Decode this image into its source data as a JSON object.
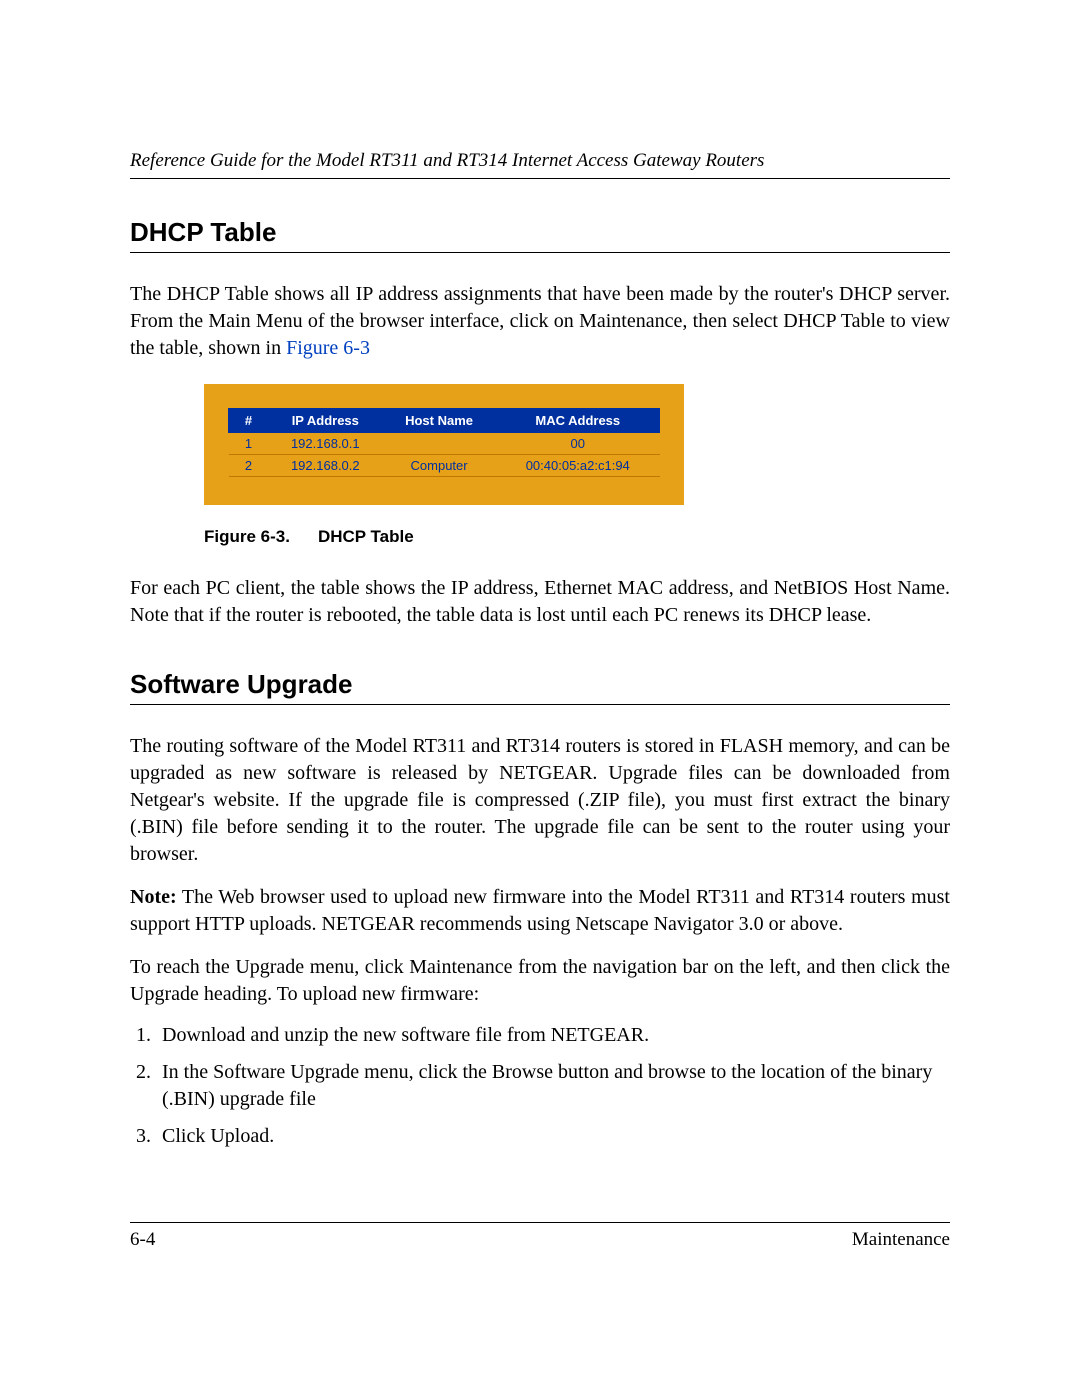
{
  "header": {
    "running_title": "Reference Guide for the Model RT311 and RT314 Internet Access Gateway Routers"
  },
  "sections": {
    "dhcp": {
      "heading": "DHCP Table",
      "para1_a": "The DHCP Table shows all IP address assignments that have been made by the router's DHCP server. From the Main Menu of the browser interface, click on Maintenance, then select DHCP Table to view the table, shown in ",
      "fig_link": "Figure 6-3",
      "para2": "For each PC client, the table shows the IP address, Ethernet MAC address, and NetBIOS Host Name. Note that if the router is rebooted, the table data is lost until each PC renews its DHCP lease."
    },
    "upgrade": {
      "heading": "Software Upgrade",
      "para1": "The routing software of the Model RT311 and RT314 routers is stored in FLASH memory, and can be upgraded as new software is released by NETGEAR. Upgrade files can be downloaded from Netgear's website. If the upgrade file is compressed (.ZIP file), you must first extract the binary (.BIN) file before sending it to the router. The upgrade file can be sent to the router using your browser.",
      "note_label": "Note:",
      "note_text": " The Web browser used to upload new firmware into the Model RT311 and RT314 routers must support HTTP uploads. NETGEAR recommends using Netscape Navigator 3.0 or above.",
      "para2": "To reach the Upgrade menu, click Maintenance from the navigation bar on the left, and then click the Upgrade heading. To upload new firmware:",
      "steps": [
        "Download and unzip the new software file from NETGEAR.",
        "In the Software Upgrade menu, click the Browse button and browse to the location of the binary (.BIN) upgrade file",
        "Click Upload."
      ]
    }
  },
  "figure": {
    "caption_label": "Figure 6-3.",
    "caption_title": "DHCP Table",
    "columns": [
      "#",
      "IP Address",
      "Host Name",
      "MAC Address"
    ],
    "rows": [
      {
        "idx": "1",
        "ip": "192.168.0.1",
        "host": "",
        "mac": "00"
      },
      {
        "idx": "2",
        "ip": "192.168.0.2",
        "host": "Computer",
        "mac": "00:40:05:a2:c1:94"
      }
    ]
  },
  "footer": {
    "page": "6-4",
    "section": "Maintenance"
  }
}
